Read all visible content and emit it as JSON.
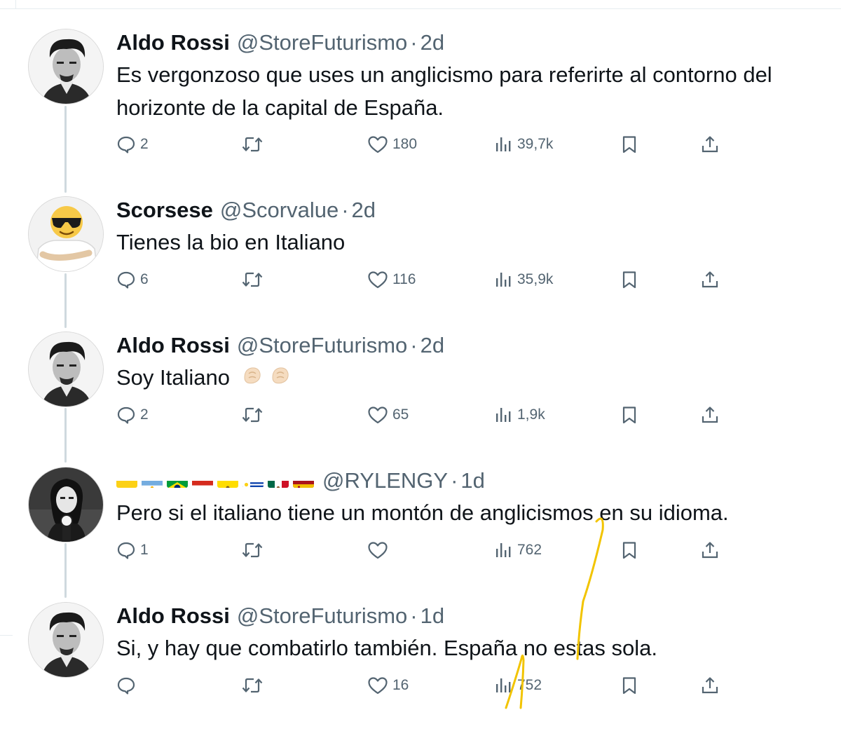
{
  "tweets": [
    {
      "name": "Aldo Rossi",
      "handle": "@StoreFuturismo",
      "time": "2d",
      "text": "Es vergonzoso que uses un anglicismo para referirte al contorno del horizonte de la capital de España.",
      "replies": "2",
      "retweets": "",
      "likes": "180",
      "views": "39,7k"
    },
    {
      "name": "Scorsese",
      "handle": "@Scorvalue",
      "time": "2d",
      "text": "Tienes la bio en Italiano",
      "replies": "6",
      "retweets": "",
      "likes": "116",
      "views": "35,9k"
    },
    {
      "name": "Aldo Rossi",
      "handle": "@StoreFuturismo",
      "time": "2d",
      "text": "Soy Italiano",
      "emoji": "pinched-fingers-icon",
      "replies": "2",
      "retweets": "",
      "likes": "65",
      "views": "1,9k"
    },
    {
      "name": "",
      "flags": [
        "colombia-flag-icon",
        "argentina-flag-icon",
        "brazil-flag-icon",
        "paraguay-flag-icon",
        "ecuador-flag-icon",
        "uruguay-flag-icon",
        "mexico-flag-icon",
        "spain-flag-icon"
      ],
      "handle": "@RYLENGY",
      "time": "1d",
      "text": "Pero si el italiano tiene un montón de anglicismos en su idioma.",
      "replies": "1",
      "retweets": "",
      "likes": "",
      "views": "762"
    },
    {
      "name": "Aldo Rossi",
      "handle": "@StoreFuturismo",
      "time": "1d",
      "text": "Si, y hay que combatirlo también. España no estas sola.",
      "replies": "",
      "retweets": "",
      "likes": "16",
      "views": "752"
    }
  ],
  "separator": "·",
  "colors": {
    "text": "#0f1419",
    "secondary": "#536471",
    "connector": "#cfd9de",
    "annotation": "#f2c400"
  },
  "icons": {
    "reply": "speech-bubble-icon",
    "retweet": "retweet-arrows-icon",
    "like": "heart-icon",
    "views": "bar-chart-icon",
    "bookmark": "bookmark-icon",
    "share": "share-upload-icon"
  }
}
